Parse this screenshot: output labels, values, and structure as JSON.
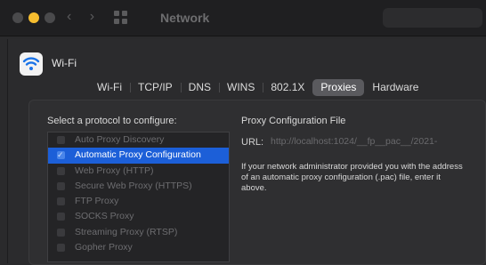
{
  "window": {
    "title": "Network"
  },
  "header": {
    "interface_name": "Wi-Fi"
  },
  "tabs": [
    {
      "label": "Wi-Fi",
      "active": false
    },
    {
      "label": "TCP/IP",
      "active": false
    },
    {
      "label": "DNS",
      "active": false
    },
    {
      "label": "WINS",
      "active": false
    },
    {
      "label": "802.1X",
      "active": false
    },
    {
      "label": "Proxies",
      "active": true
    },
    {
      "label": "Hardware",
      "active": false
    }
  ],
  "protocols": {
    "heading": "Select a protocol to configure:",
    "items": [
      {
        "label": "Auto Proxy Discovery",
        "checked": false,
        "selected": false
      },
      {
        "label": "Automatic Proxy Configuration",
        "checked": true,
        "selected": true
      },
      {
        "label": "Web Proxy (HTTP)",
        "checked": false,
        "selected": false
      },
      {
        "label": "Secure Web Proxy (HTTPS)",
        "checked": false,
        "selected": false
      },
      {
        "label": "FTP Proxy",
        "checked": false,
        "selected": false
      },
      {
        "label": "SOCKS Proxy",
        "checked": false,
        "selected": false
      },
      {
        "label": "Streaming Proxy (RTSP)",
        "checked": false,
        "selected": false
      },
      {
        "label": "Gopher Proxy",
        "checked": false,
        "selected": false
      }
    ]
  },
  "proxy_config": {
    "title": "Proxy Configuration File",
    "url_label": "URL:",
    "url_value": "http://localhost:1024/__fp__pac__/2021-",
    "help_text": "If your network administrator provided you with the address of an automatic proxy configuration (.pac) file, enter it above."
  },
  "colors": {
    "accent": "#1c5fd8",
    "traffic_minimize": "#f6bd2f"
  }
}
